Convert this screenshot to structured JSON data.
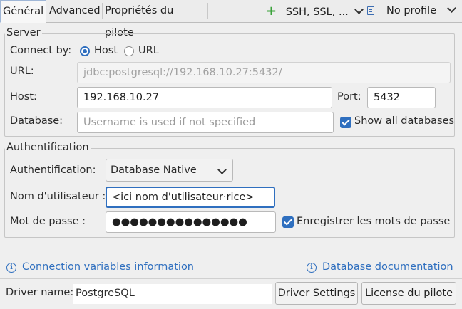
{
  "tabs": [
    {
      "label": "Général",
      "active": true
    },
    {
      "label": "Advanced",
      "active": false
    },
    {
      "label": "Propriétés du pilote",
      "active": false
    }
  ],
  "toolbar": {
    "ssh_label": "SSH, SSL, ...",
    "profile_label": "No profile"
  },
  "server": {
    "legend": "Server",
    "connect_by_label": "Connect by:",
    "connect_options": [
      "Host",
      "URL"
    ],
    "connect_selected": "Host",
    "url_label": "URL:",
    "url_value": "jdbc:postgresql://192.168.10.27:5432/",
    "host_label": "Host:",
    "host_value": "192.168.10.27",
    "port_label": "Port:",
    "port_value": "5432",
    "database_label": "Database:",
    "database_placeholder": "Username is used if not specified",
    "show_all_label": "Show all databases",
    "show_all_checked": true
  },
  "auth": {
    "legend": "Authentification",
    "method_label": "Authentification:",
    "method_value": "Database Native",
    "user_label": "Nom d'utilisateur :",
    "user_value": "<ici nom d'utilisateur·rice>",
    "password_label": "Mot de passe :",
    "password_value": "●●●●●●●●●●●●●●●",
    "save_pw_label": "Enregistrer les mots de passe",
    "save_pw_checked": true
  },
  "links": {
    "conn_vars": "Connection variables information",
    "db_docs": "Database documentation"
  },
  "driver": {
    "label": "Driver name:",
    "value": "PostgreSQL",
    "settings_btn": "Driver Settings",
    "license_btn": "License du pilote"
  },
  "colors": {
    "accent": "#2f6fbf",
    "add_icon": "#3aa23a"
  }
}
